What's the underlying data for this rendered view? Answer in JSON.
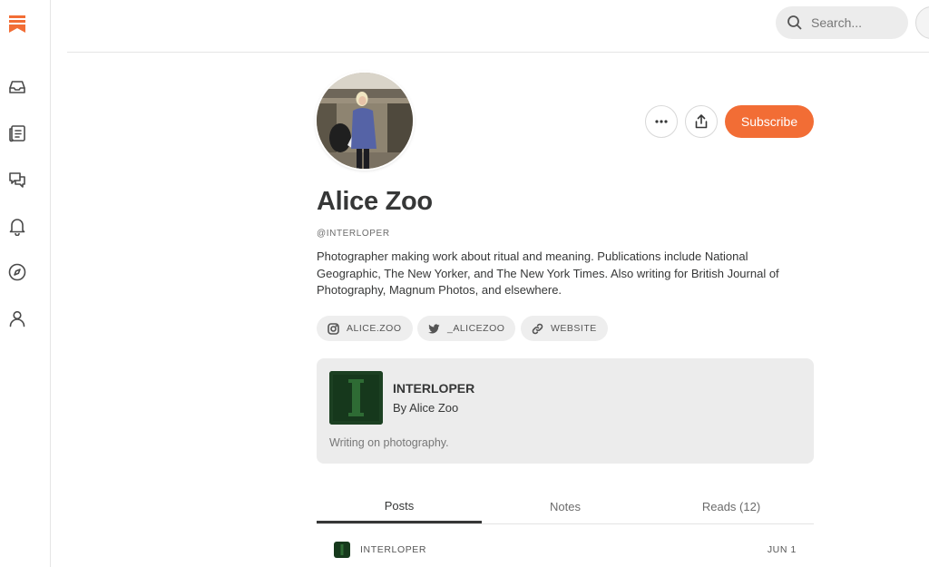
{
  "app": {
    "logo_icon": "bookmark-stack-logo-icon",
    "brand_color": "#f26d35"
  },
  "sidebar": {
    "items": [
      {
        "name": "inbox",
        "icon": "inbox-icon"
      },
      {
        "name": "reader",
        "icon": "reader-icon"
      },
      {
        "name": "chat",
        "icon": "chat-icon"
      },
      {
        "name": "notifications",
        "icon": "bell-icon"
      },
      {
        "name": "explore",
        "icon": "compass-icon"
      },
      {
        "name": "profile",
        "icon": "person-icon"
      }
    ]
  },
  "search": {
    "placeholder": "Search..."
  },
  "profile": {
    "name": "Alice Zoo",
    "handle": "@INTERLOPER",
    "bio": "Photographer making work about ritual and meaning. Publications include National Geographic, The New Yorker, and The New York Times. Also writing for British Journal of Photography, Magnum Photos, and elsewhere.",
    "subscribe_label": "Subscribe",
    "links": [
      {
        "icon": "instagram-icon",
        "label": "ALICE.ZOO"
      },
      {
        "icon": "twitter-icon",
        "label": "_ALICEZOO"
      },
      {
        "icon": "link-icon",
        "label": "WEBSITE"
      }
    ]
  },
  "publication": {
    "name": "INTERLOPER",
    "author": "By Alice Zoo",
    "description": "Writing on photography."
  },
  "tabs": [
    {
      "label": "Posts",
      "active": true
    },
    {
      "label": "Notes",
      "active": false
    },
    {
      "label": "Reads (12)",
      "active": false
    }
  ],
  "posts": [
    {
      "publication": "INTERLOPER",
      "date": "JUN 1"
    }
  ]
}
